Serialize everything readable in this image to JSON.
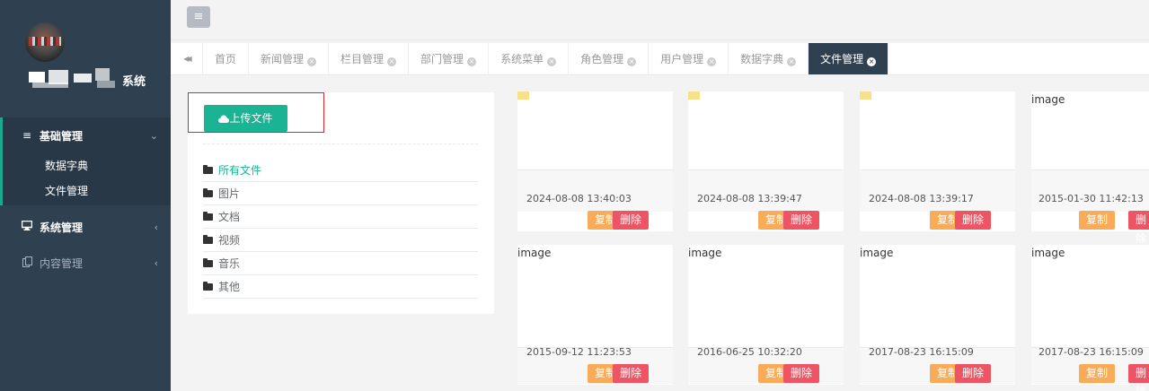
{
  "sidebar": {
    "brand_suffix": "系统",
    "menu": [
      {
        "label": "基础管理",
        "icon": "list-icon",
        "icon_glyph": "≡",
        "arrow": "⌄"
      },
      {
        "label": "系统管理",
        "icon": "desktop-icon",
        "icon_glyph": "🖵",
        "arrow": "‹"
      },
      {
        "label": "内容管理",
        "icon": "copy-icon",
        "icon_glyph": "⧉",
        "arrow": "‹"
      }
    ],
    "submenu": [
      "数据字典",
      "文件管理"
    ]
  },
  "topbar": {
    "menu_icon": "≡"
  },
  "tabs": {
    "prev_icon": "◀◀",
    "items": [
      {
        "label": "首页",
        "closable": false
      },
      {
        "label": "新闻管理",
        "closable": true
      },
      {
        "label": "栏目管理",
        "closable": true
      },
      {
        "label": "部门管理",
        "closable": true
      },
      {
        "label": "系统菜单",
        "closable": true
      },
      {
        "label": "角色管理",
        "closable": true
      },
      {
        "label": "用户管理",
        "closable": true
      },
      {
        "label": "数据字典",
        "closable": true
      },
      {
        "label": "文件管理",
        "closable": true,
        "active": true
      }
    ],
    "close_glyph": "×"
  },
  "folders": {
    "upload_label": "上传文件",
    "items": [
      "所有文件",
      "图片",
      "文档",
      "视频",
      "音乐",
      "其他"
    ]
  },
  "files": {
    "copy_label": "复制",
    "delete_label": "删除",
    "items": [
      {
        "alt": "",
        "thumb": true,
        "date": "2024-08-08 13:40:03"
      },
      {
        "alt": "",
        "thumb": true,
        "date": "2024-08-08 13:39:47"
      },
      {
        "alt": "",
        "thumb": true,
        "date": "2024-08-08 13:39:17"
      },
      {
        "alt": "image",
        "thumb": false,
        "date": "2015-01-30 11:42:13"
      },
      {
        "alt": "image",
        "thumb": false,
        "date": "2015-09-12 11:23:53"
      },
      {
        "alt": "image",
        "thumb": false,
        "date": "2016-06-25 10:32:20"
      },
      {
        "alt": "image",
        "thumb": false,
        "date": "2017-08-23 16:15:09"
      },
      {
        "alt": "image",
        "thumb": false,
        "date": "2017-08-23 16:15:09"
      }
    ]
  },
  "colors": {
    "sidebar": "#2f4050",
    "accent": "#1ab394",
    "copy": "#f8ac59",
    "delete": "#ed5565"
  }
}
